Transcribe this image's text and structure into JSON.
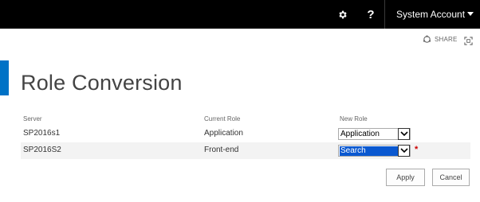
{
  "header": {
    "user_name": "System Account",
    "help_label": "?",
    "settings_icon": "gear-icon",
    "menu_icon": "chevron-down-icon"
  },
  "ribbon": {
    "share_label": "SHARE",
    "share_icon": "share-icon",
    "focus_icon": "focus-on-content-icon"
  },
  "page": {
    "title": "Role Conversion",
    "accent_color": "#0072c6"
  },
  "table": {
    "headers": {
      "server": "Server",
      "current_role": "Current Role",
      "new_role": "New Role"
    },
    "rows": [
      {
        "server": "SP2016s1",
        "current_role": "Application",
        "new_role": "Application"
      },
      {
        "server": "SP2016S2",
        "current_role": "Front-end",
        "new_role": "Search"
      }
    ],
    "required_marker": "*"
  },
  "actions": {
    "apply_label": "Apply",
    "cancel_label": "Cancel"
  }
}
